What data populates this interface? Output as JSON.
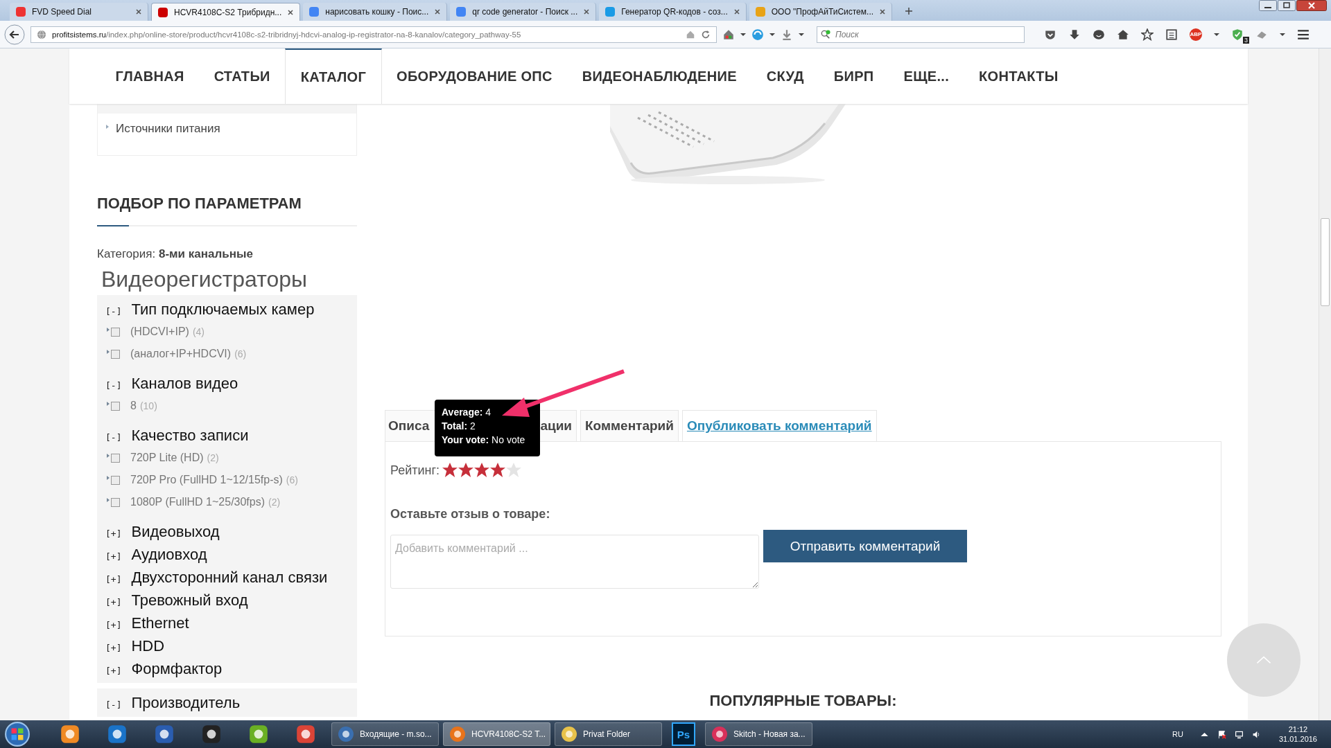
{
  "browser": {
    "tabs": [
      {
        "title": "FVD Speed Dial",
        "selected": false
      },
      {
        "title": "HCVR4108C-S2 Трибридн...",
        "selected": true
      },
      {
        "title": "нарисовать кошку - Поис...",
        "selected": false
      },
      {
        "title": "qr code generator - Поиск ...",
        "selected": false
      },
      {
        "title": "Генератор QR-кодов - соз...",
        "selected": false
      },
      {
        "title": "ООО \"ПрофАйТиСистем...",
        "selected": false
      }
    ],
    "url": {
      "domain": "profitsistems.ru",
      "path": "/index.php/online-store/product/hcvr4108c-s2-tribridnyj-hdcvi-analog-ip-registrator-na-8-kanalov/category_pathway-55"
    },
    "search": {
      "placeholder": "Поиск"
    },
    "adblock": "ABP",
    "shield_badge": "3"
  },
  "nav": [
    {
      "label": "ГЛАВНАЯ",
      "selected": false
    },
    {
      "label": "СТАТЬИ",
      "selected": false
    },
    {
      "label": "КАТАЛОГ",
      "selected": true
    },
    {
      "label": "ОБОРУДОВАНИЕ ОПС",
      "selected": false
    },
    {
      "label": "ВИДЕОНАБЛЮДЕНИЕ",
      "selected": false
    },
    {
      "label": "СКУД",
      "selected": false
    },
    {
      "label": "БИРП",
      "selected": false
    },
    {
      "label": "ЕЩЕ...",
      "selected": false
    },
    {
      "label": "КОНТАКТЫ",
      "selected": false
    }
  ],
  "sidebar": {
    "menu_item": "Источники питания",
    "filter_title": "ПОДБОР ПО ПАРАМЕТРАМ",
    "category": "Категория: **8-ми канальные**",
    "heading": "Видеорегистраторы",
    "panels": [
      {
        "groups": [
          {
            "toggle": "[-]",
            "label": "Тип подключаемых камер",
            "options": [
              {
                "label": "(HDCVI+IP)",
                "count": "(4)",
                "checked": false
              },
              {
                "label": "(аналог+IP+HDCVI)",
                "count": "(6)",
                "checked": false
              }
            ]
          },
          {
            "toggle": "[-]",
            "label": "Каналов видео",
            "options": [
              {
                "label": "8",
                "count": "(10)",
                "checked": false
              }
            ]
          },
          {
            "toggle": "[-]",
            "label": "Качество записи",
            "options": [
              {
                "label": "720P Lite (HD)",
                "count": "(2)",
                "checked": false
              },
              {
                "label": "720P Pro (FullHD 1~12/15fp-s)",
                "count": "(6)",
                "checked": false
              },
              {
                "label": "1080P (FullHD 1~25/30fps)",
                "count": "(2)",
                "checked": false
              }
            ]
          },
          {
            "toggle": "[+]",
            "label": "Видеовыход"
          },
          {
            "toggle": "[+]",
            "label": "Аудиовход"
          },
          {
            "toggle": "[+]",
            "label": "Двухсторонний канал связи"
          },
          {
            "toggle": "[+]",
            "label": "Тревожный вход"
          },
          {
            "toggle": "[+]",
            "label": "Ethernet"
          },
          {
            "toggle": "[+]",
            "label": "HDD"
          },
          {
            "toggle": "[+]",
            "label": "Формфактор"
          }
        ]
      },
      {
        "groups": [
          {
            "toggle": "[-]",
            "label": "Производитель"
          }
        ]
      }
    ]
  },
  "product": {
    "tabs": [
      {
        "label": "Описа",
        "selected": false
      },
      {
        "label": "ации",
        "selected": false
      },
      {
        "label": "Комментарий",
        "selected": false
      },
      {
        "label": "Опубликовать комментарий",
        "selected": true
      }
    ],
    "tooltip": [
      {
        "label": "Average:",
        "value": "4"
      },
      {
        "label": "Total:",
        "value": "2"
      },
      {
        "label": "Your vote:",
        "value": "No vote"
      }
    ],
    "rating_label": "Рейтинг:",
    "stars": 4,
    "review_heading": "Оставьте отзыв о товаре:",
    "comment": {
      "placeholder": "Добавить комментарий ..."
    },
    "submit": "Отправить комментарий",
    "popular_heading": "ПОПУЛЯРНЫЕ ТОВАРЫ:"
  },
  "taskbar": {
    "tasks": [
      {
        "kind": "button",
        "label": "Входящие - m.so...",
        "selected": false
      },
      {
        "kind": "button",
        "label": "HCVR4108C-S2 T...",
        "selected": true
      },
      {
        "kind": "button",
        "label": "Privat Folder",
        "selected": false
      },
      {
        "kind": "icon",
        "label": "Ps",
        "selected": false
      },
      {
        "kind": "button",
        "label": "Skitch - Новая за...",
        "selected": false
      }
    ],
    "language": "RU",
    "time": "21:12",
    "date": "31.01.2016"
  }
}
